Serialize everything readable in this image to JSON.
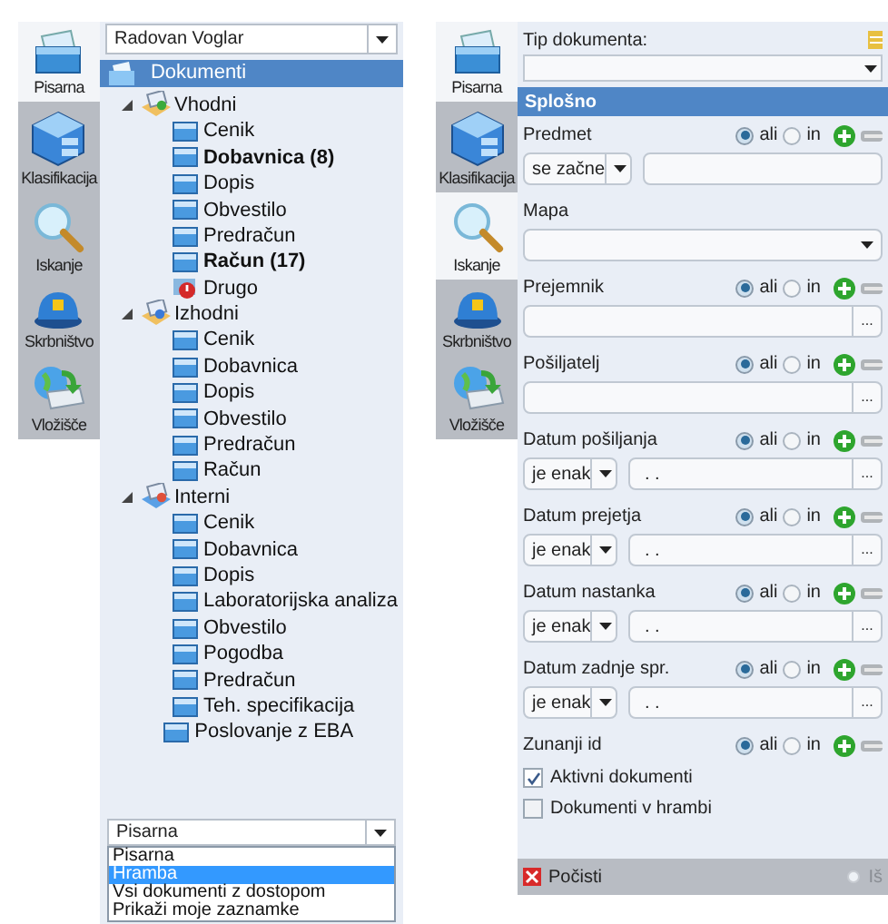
{
  "left_screen": {
    "nav": [
      {
        "label": "Pisarna",
        "selected": true
      },
      {
        "label": "Klasifikacija",
        "selected": false
      },
      {
        "label": "Iskanje",
        "selected": false
      },
      {
        "label": "Skrbništvo",
        "selected": false
      },
      {
        "label": "Vložišče",
        "selected": false
      }
    ],
    "user_select": {
      "value": "Radovan Voglar"
    },
    "tree_header": "Dokumenti",
    "tree": [
      {
        "label": "Vhodni",
        "kind": "inbox",
        "bold": false,
        "expanded": true,
        "children": [
          {
            "label": "Cenik",
            "kind": "folder",
            "bold": false
          },
          {
            "label": "Dobavnica (8)",
            "kind": "folder",
            "bold": true
          },
          {
            "label": "Dopis",
            "kind": "folder",
            "bold": false
          },
          {
            "label": "Obvestilo",
            "kind": "folder",
            "bold": false
          },
          {
            "label": "Predračun",
            "kind": "folder",
            "bold": false
          },
          {
            "label": "Račun (17)",
            "kind": "folder",
            "bold": true
          },
          {
            "label": "Drugo",
            "kind": "alert",
            "bold": false
          }
        ]
      },
      {
        "label": "Izhodni",
        "kind": "outbox",
        "bold": false,
        "expanded": true,
        "children": [
          {
            "label": "Cenik",
            "kind": "folder",
            "bold": false
          },
          {
            "label": "Dobavnica",
            "kind": "folder",
            "bold": false
          },
          {
            "label": "Dopis",
            "kind": "folder",
            "bold": false
          },
          {
            "label": "Obvestilo",
            "kind": "folder",
            "bold": false
          },
          {
            "label": "Predračun",
            "kind": "folder",
            "bold": false
          },
          {
            "label": "Račun",
            "kind": "folder",
            "bold": false
          }
        ]
      },
      {
        "label": "Interni",
        "kind": "internal",
        "bold": false,
        "expanded": true,
        "children": [
          {
            "label": "Cenik",
            "kind": "folder",
            "bold": false
          },
          {
            "label": "Dobavnica",
            "kind": "folder",
            "bold": false
          },
          {
            "label": "Dopis",
            "kind": "folder",
            "bold": false
          },
          {
            "label": "Laboratorijska analiza",
            "kind": "folder",
            "bold": false
          },
          {
            "label": "Obvestilo",
            "kind": "folder",
            "bold": false
          },
          {
            "label": "Pogodba",
            "kind": "folder",
            "bold": false
          },
          {
            "label": "Predračun",
            "kind": "folder",
            "bold": false
          },
          {
            "label": "Teh. specifikacija",
            "kind": "folder",
            "bold": false
          }
        ]
      },
      {
        "label": "Poslovanje z EBA",
        "kind": "folder",
        "bold": false
      }
    ],
    "view_select": {
      "value": "Pisarna",
      "options": [
        {
          "label": "Pisarna",
          "highlighted": false
        },
        {
          "label": "Hramba",
          "highlighted": true
        },
        {
          "label": "Vsi dokumenti z dostopom",
          "highlighted": false
        },
        {
          "label": "Prikaži moje zaznamke",
          "highlighted": false
        }
      ]
    }
  },
  "right_screen": {
    "nav": [
      {
        "label": "Pisarna",
        "selected": true
      },
      {
        "label": "Klasifikacija",
        "selected": false
      },
      {
        "label": "Iskanje",
        "selected": true
      },
      {
        "label": "Skrbništvo",
        "selected": false
      },
      {
        "label": "Vložišče",
        "selected": false
      }
    ],
    "doc_type_label": "Tip dokumenta:",
    "section": "Splošno",
    "fields": [
      {
        "label": "Predmet",
        "kind": "operator",
        "operator": "se začne",
        "ali": "ali",
        "in": "in",
        "ali_selected": true
      },
      {
        "label": "Mapa",
        "kind": "dropdown"
      },
      {
        "label": "Prejemnik",
        "kind": "picker",
        "ali": "ali",
        "in": "in",
        "ali_selected": true,
        "button": "..."
      },
      {
        "label": "Pošiljatelj",
        "kind": "picker",
        "ali": "ali",
        "in": "in",
        "ali_selected": true,
        "button": "..."
      },
      {
        "label": "Datum pošiljanja",
        "kind": "date",
        "operator": "je enak",
        "value": ". .",
        "ali": "ali",
        "in": "in",
        "ali_selected": true,
        "button": "..."
      },
      {
        "label": "Datum prejetja",
        "kind": "date",
        "operator": "je enak",
        "value": ". .",
        "ali": "ali",
        "in": "in",
        "ali_selected": true,
        "button": "..."
      },
      {
        "label": "Datum nastanka",
        "kind": "date",
        "operator": "je enak",
        "value": ". .",
        "ali": "ali",
        "in": "in",
        "ali_selected": true,
        "button": "..."
      },
      {
        "label": "Datum zadnje spr.",
        "kind": "date",
        "operator": "je enak",
        "value": ". .",
        "ali": "ali",
        "in": "in",
        "ali_selected": true,
        "button": "..."
      },
      {
        "label": "Zunanji id",
        "kind": "label_only",
        "ali": "ali",
        "in": "in",
        "ali_selected": true
      }
    ],
    "checkboxes": [
      {
        "label": "Aktivni dokumenti",
        "checked": true
      },
      {
        "label": "Dokumenti v hrambi",
        "checked": false
      }
    ],
    "clear_button": "Počisti",
    "search_button": "Iš"
  }
}
